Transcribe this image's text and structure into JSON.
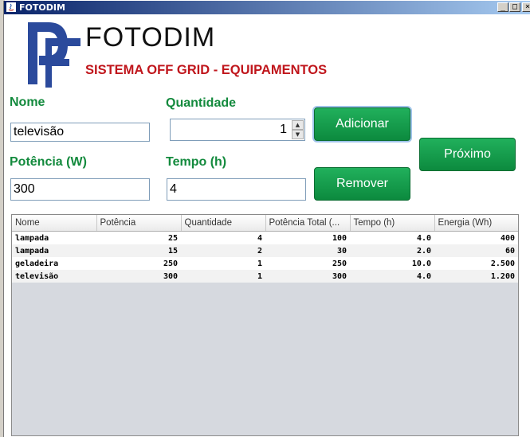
{
  "window": {
    "title": "FOTODIM",
    "controls": {
      "minimize": "_",
      "maximize": "□",
      "close": "×"
    }
  },
  "brand": {
    "name": "FOTODIM",
    "subtitle": "SISTEMA OFF GRID - EQUIPAMENTOS",
    "logo_color": "#2b4a9c"
  },
  "form": {
    "nome_label": "Nome",
    "nome_value": "televisão",
    "quantidade_label": "Quantidade",
    "quantidade_value": "1",
    "potencia_label": "Potência (W)",
    "potencia_value": "300",
    "tempo_label": "Tempo (h)",
    "tempo_value": "4"
  },
  "buttons": {
    "adicionar": "Adicionar",
    "remover": "Remover",
    "proximo": "Próximo",
    "accent": "#16a04e"
  },
  "table": {
    "columns": [
      "Nome",
      "Potência",
      "Quantidade",
      "Potência Total (...",
      "Tempo (h)",
      "Energia (Wh)"
    ],
    "rows": [
      [
        "lampada",
        "25",
        "4",
        "100",
        "4.0",
        "400"
      ],
      [
        "lampada",
        "15",
        "2",
        "30",
        "2.0",
        "60"
      ],
      [
        "geladeira",
        "250",
        "1",
        "250",
        "10.0",
        "2.500"
      ],
      [
        "televisão",
        "300",
        "1",
        "300",
        "4.0",
        "1.200"
      ]
    ]
  }
}
